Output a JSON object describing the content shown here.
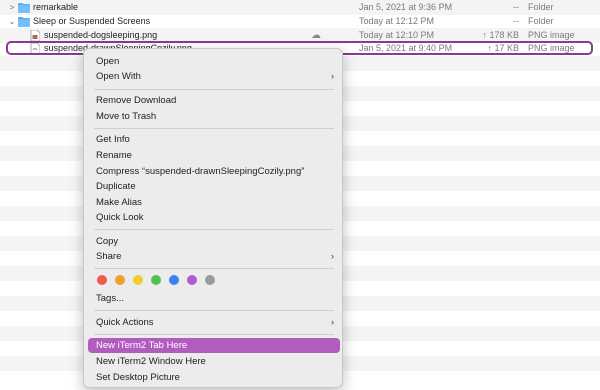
{
  "files": [
    {
      "name": "remarkable",
      "date": "Jan 5, 2021 at 9:36 PM",
      "size": "--",
      "kind": "Folder",
      "icon": "folder-icon",
      "expanded": false
    },
    {
      "name": "Sleep or Suspended Screens",
      "date": "Today at 12:12 PM",
      "size": "--",
      "kind": "Folder",
      "icon": "folder-icon",
      "expanded": true
    },
    {
      "name": "suspended-dogsleeping.png",
      "date": "Today at 12:10 PM",
      "size": "↑ 178 KB",
      "kind": "PNG image",
      "icon": "png-file-icon",
      "cloud": "☁"
    },
    {
      "name": "suspended-drawnSleepingCozily.png",
      "date": "Jan 5, 2021 at 9:40 PM",
      "size": "↑ 17 KB",
      "kind": "PNG image",
      "icon": "png-file-icon"
    }
  ],
  "menu": {
    "open": "Open",
    "open_with": "Open With",
    "remove_download": "Remove Download",
    "move_to_trash": "Move to Trash",
    "get_info": "Get Info",
    "rename": "Rename",
    "compress": "Compress “suspended-drawnSleepingCozily.png”",
    "duplicate": "Duplicate",
    "make_alias": "Make Alias",
    "quick_look": "Quick Look",
    "copy": "Copy",
    "share": "Share",
    "tags": "Tags...",
    "quick_actions": "Quick Actions",
    "new_iterm2_tab": "New iTerm2 Tab Here",
    "new_iterm2_window": "New iTerm2 Window Here",
    "set_desktop_picture": "Set Desktop Picture",
    "submenu_arrow": "›"
  },
  "tag_colors": [
    {
      "name": "red",
      "color": "#f05a4e"
    },
    {
      "name": "orange",
      "color": "#f59d2a"
    },
    {
      "name": "yellow",
      "color": "#f2cd2e"
    },
    {
      "name": "green",
      "color": "#52c24a"
    },
    {
      "name": "blue",
      "color": "#3b82f0"
    },
    {
      "name": "purple",
      "color": "#b35ad1"
    },
    {
      "name": "gray",
      "color": "#9a9a9a"
    }
  ],
  "accent_color": "#b25cc0"
}
